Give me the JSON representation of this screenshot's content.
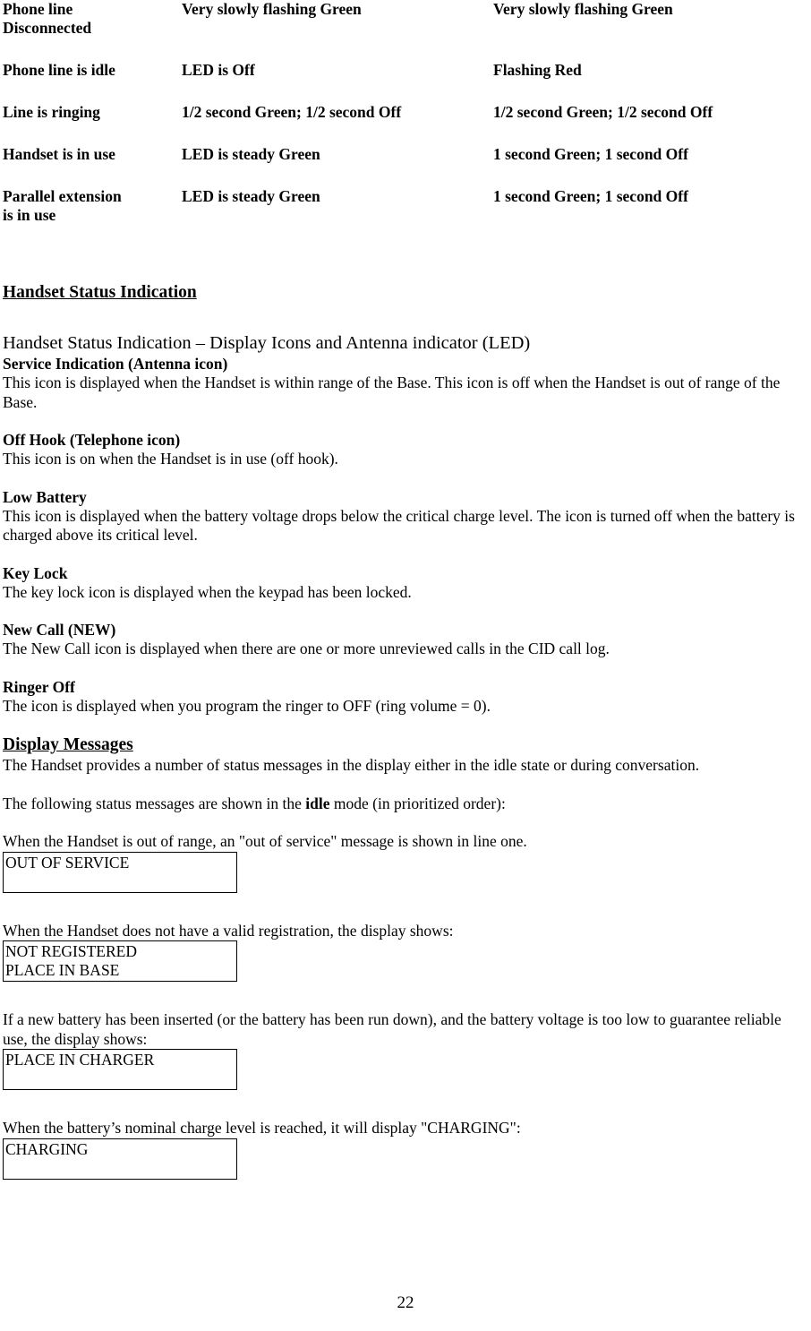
{
  "document": {
    "page_number": "22"
  },
  "led_table": {
    "rows": [
      {
        "state": "Phone line\nDisconnected",
        "base_led": "Very slowly flashing Green",
        "handset_led": "Very slowly flashing Green"
      },
      {
        "state": "Phone line is idle",
        "base_led": "LED is Off",
        "handset_led": "Flashing  Red"
      },
      {
        "state": "Line is ringing",
        "base_led": "1/2 second Green; 1/2 second Off",
        "handset_led": "1/2 second Green; 1/2 second Off"
      },
      {
        "state": "Handset is in use",
        "base_led": "LED  is steady Green",
        "handset_led": "1 second Green; 1 second Off"
      },
      {
        "state": "Parallel extension\nis in use",
        "base_led": "LED is steady Green",
        "handset_led": "1 second Green; 1 second Off"
      }
    ]
  },
  "handset_status": {
    "heading": "Handset Status Indication",
    "intro": "Handset Status Indication – Display Icons and Antenna indicator (LED)",
    "items": [
      {
        "label": "Service Indication  (Antenna icon)",
        "description": "This icon is displayed when the Handset is within range of the Base. This icon is off when the Handset is out of range of the Base."
      },
      {
        "label": "Off Hook (Telephone icon)",
        "description": "This icon is on when the Handset is in use (off hook)."
      },
      {
        "label": "Low Battery",
        "description": "This icon is displayed when the battery voltage drops below the critical charge level. The icon is turned off when the battery is charged above its critical level."
      },
      {
        "label": "Key Lock",
        "description": "The key lock icon is displayed when the keypad has been locked."
      },
      {
        "label": "New Call (NEW)",
        "description": "The New Call icon is displayed when there are one or more unreviewed calls in the CID call log."
      },
      {
        "label": "Ringer Off",
        "description": "The icon is displayed when you program the ringer to OFF (ring volume = 0)."
      }
    ]
  },
  "display_messages": {
    "heading": "Display Messages",
    "intro": "The Handset provides a number of status messages in the display either in the idle state or during conversation.",
    "prioritized_note_before": "The following status messages are shown in the ",
    "prioritized_note_bold": "idle",
    "prioritized_note_after": " mode (in prioritized order):",
    "entries": [
      {
        "caption": "When the Handset is out of range, an \"out of service\" message is shown in line one.",
        "lcd_line1": "OUT OF SERVICE",
        "lcd_line2": ""
      },
      {
        "caption": "When the Handset does not have a valid registration, the display shows:",
        "lcd_line1": "NOT REGISTERED",
        "lcd_line2": "PLACE IN BASE"
      },
      {
        "caption": "If a new battery has been inserted (or the battery has been run down), and the battery voltage is too low to guarantee reliable use, the display shows:",
        "lcd_line1": "PLACE IN CHARGER",
        "lcd_line2": ""
      },
      {
        "caption": "When the battery’s nominal charge level is reached, it will display \"CHARGING\":",
        "lcd_line1": "CHARGING",
        "lcd_line2": ""
      }
    ]
  }
}
